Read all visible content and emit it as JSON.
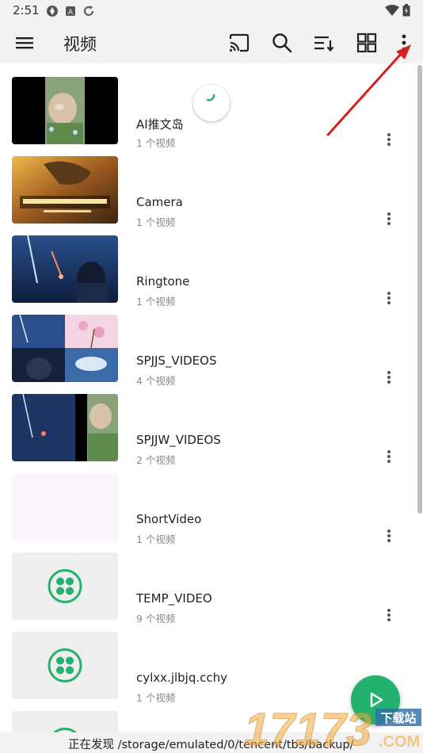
{
  "status_bar": {
    "time": "2:51"
  },
  "app_bar": {
    "title": "视频",
    "menu_icon": "hamburger-menu-icon",
    "actions": [
      "cast-icon",
      "search-icon",
      "sort-icon",
      "grid-view-icon",
      "more-vert-icon"
    ]
  },
  "folders": [
    {
      "name": "AI推文岛",
      "count": "1 个视频",
      "thumb": "photo"
    },
    {
      "name": "Camera",
      "count": "1 个视频",
      "thumb": "photo"
    },
    {
      "name": "Ringtone",
      "count": "1 个视频",
      "thumb": "photo"
    },
    {
      "name": "SPJJS_VIDEOS",
      "count": "4 个视频",
      "thumb": "photo"
    },
    {
      "name": "SPJJW_VIDEOS",
      "count": "2 个视频",
      "thumb": "photo"
    },
    {
      "name": "ShortVideo",
      "count": "1 个视频",
      "thumb": "blank"
    },
    {
      "name": "TEMP_VIDEO",
      "count": "9 个视频",
      "thumb": "app-icon"
    },
    {
      "name": "cylxx.jlbjq.cchy",
      "count": "1 个视频",
      "thumb": "app-icon"
    }
  ],
  "scan_status": "正在发现 /storage/emulated/0/tencent/tbs/backup/",
  "watermark": {
    "number": "17173",
    "label": "下载站",
    "domain": ".COM"
  },
  "colors": {
    "accent": "#23b26d",
    "arrow": "#d42020"
  }
}
